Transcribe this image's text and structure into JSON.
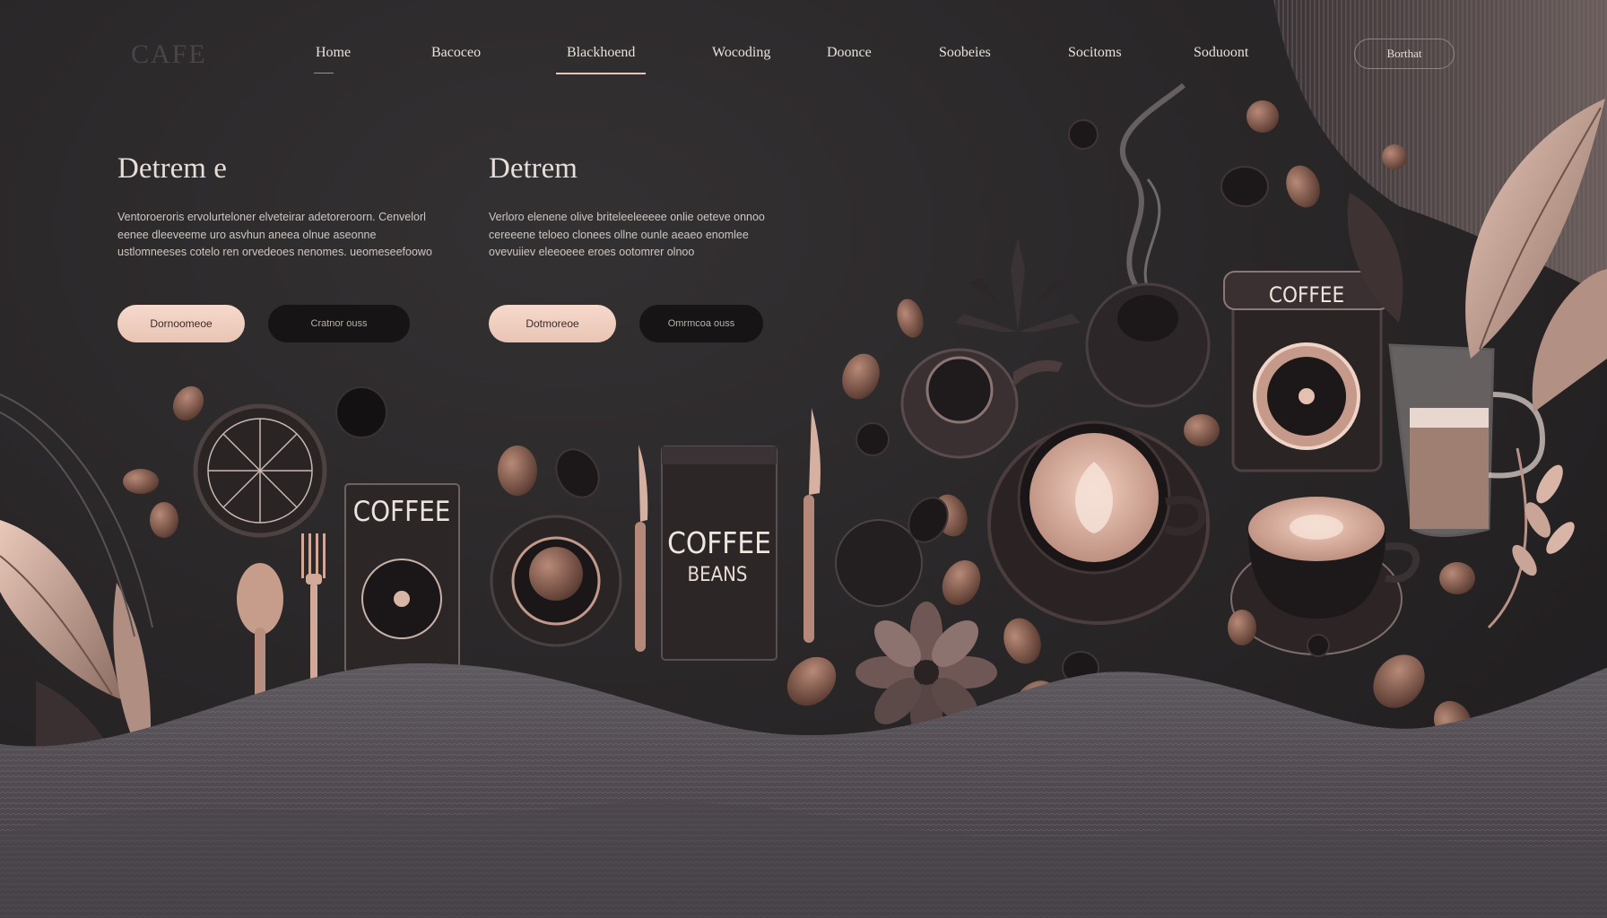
{
  "logo": "CAFE",
  "nav": {
    "links": [
      "Home",
      "Bacoceo",
      "Blackhoend",
      "Wocoding",
      "Doonce",
      "Soobeies",
      "Socitoms",
      "Soduoont"
    ],
    "active_index": 2,
    "cta_label": "Borthat"
  },
  "hero": [
    {
      "title": "Detrem e",
      "text": "Ventoroeroris ervolurteloner elveteirar adetoreroorn. Cenvelorl eenee dleeveeme uro asvhun aneea olnue aseonne ustlomneeses cotelo ren orvedeoes nenomes. ueomeseefoowo",
      "primary_label": "Dornoomeoe",
      "secondary_label": "Cratnor ouss"
    },
    {
      "title": "Detrem",
      "text": "Verloro elenene olive briteleeleeeee onlie oeteve onnoo cereeene teloeo clonees ollne ounle aeaeo enomlee ovevuiiev eleeoeee eroes ootomrer olnoo",
      "primary_label": "Dotmoreoe",
      "secondary_label": "Omrmcoa ouss"
    }
  ],
  "art_labels": {
    "coffee_tin": "COFFEE",
    "coffee_box": "COFFEE",
    "coffee_beans_bag_top": "COFFEE",
    "coffee_beans_bag_bottom": "BEANS"
  },
  "colors": {
    "background": "#2a2729",
    "accent": "#e8c6b8",
    "cream": "#f3d7ca",
    "dark_brown": "#3b2a25",
    "mid_brown": "#8a6557"
  }
}
